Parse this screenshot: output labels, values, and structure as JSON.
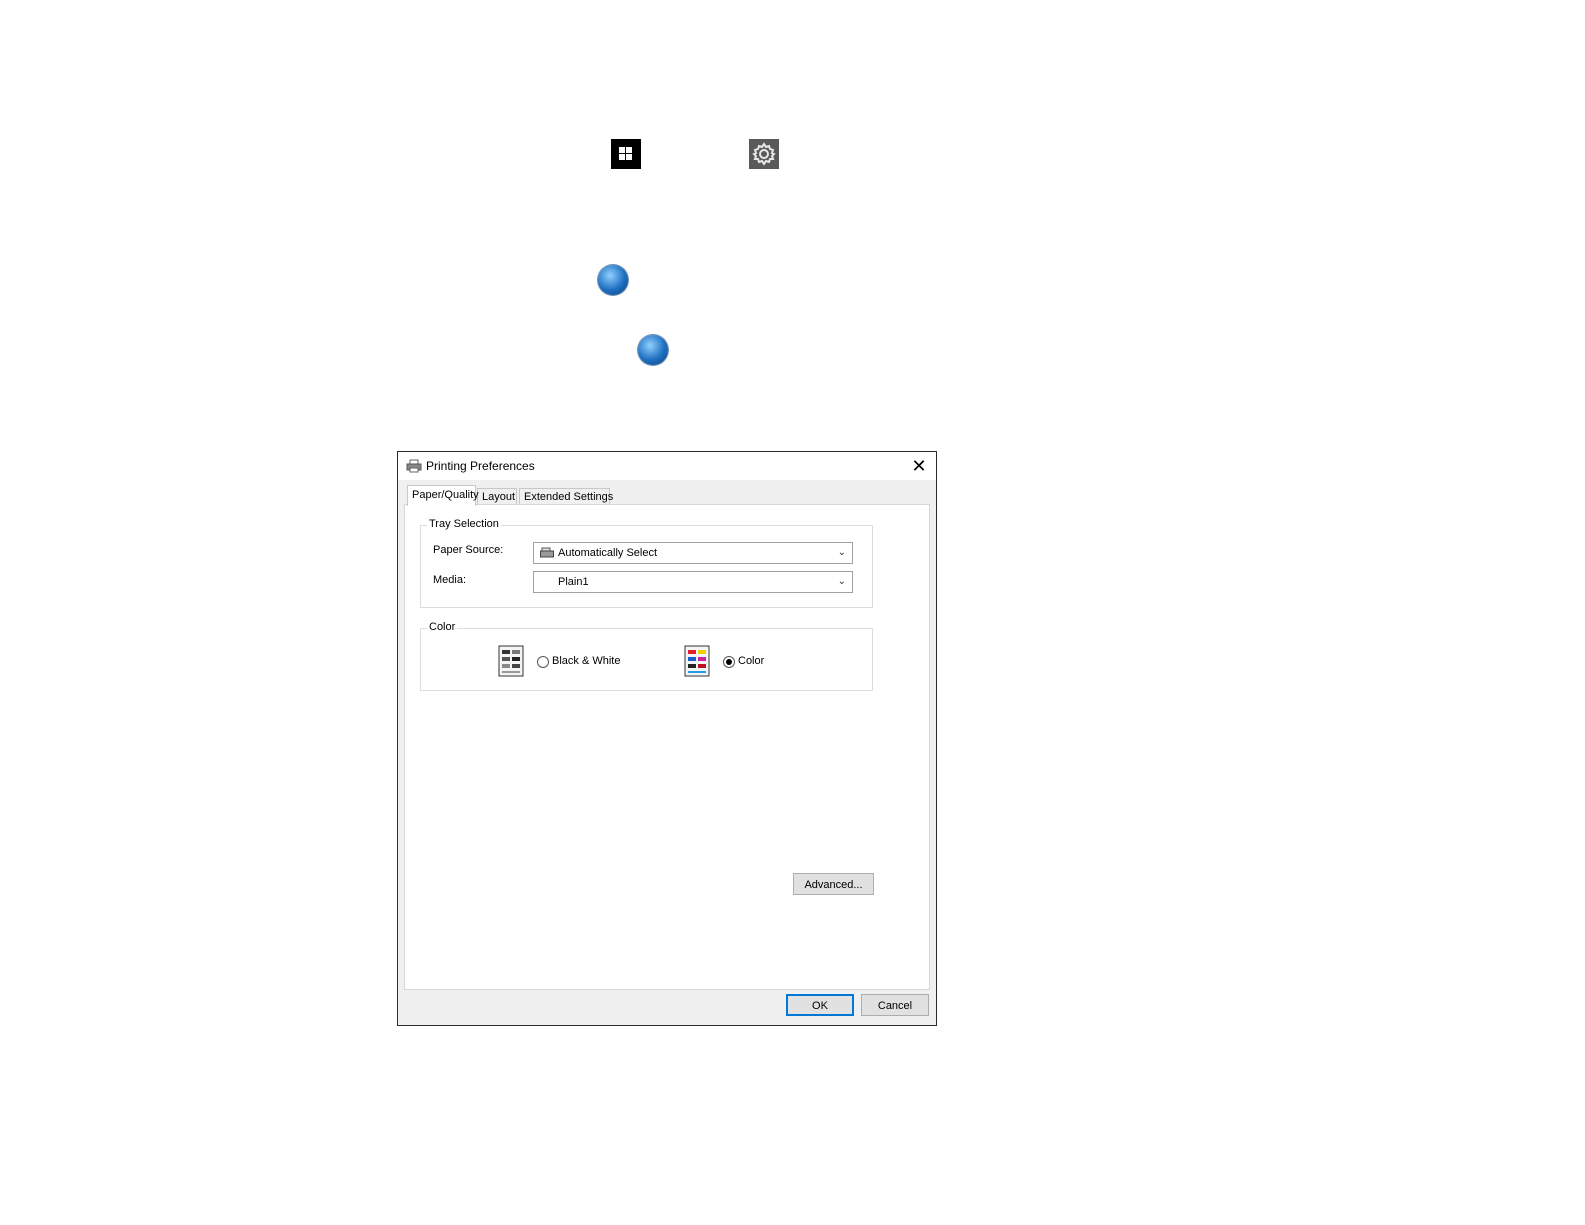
{
  "dialog": {
    "title": "Printing Preferences",
    "close_glyph": "✕",
    "tabs": [
      {
        "label": "Paper/Quality",
        "active": true
      },
      {
        "label": "Layout",
        "active": false
      },
      {
        "label": "Extended Settings",
        "active": false
      }
    ],
    "tray_selection": {
      "legend": "Tray Selection",
      "paper_source_label": "Paper Source:",
      "paper_source_value": "Automatically Select",
      "media_label": "Media:",
      "media_value": "Plain1"
    },
    "color": {
      "legend": "Color",
      "options": [
        {
          "label": "Black & White",
          "selected": false
        },
        {
          "label": "Color",
          "selected": true
        }
      ]
    },
    "advanced_label": "Advanced...",
    "ok_label": "OK",
    "cancel_label": "Cancel"
  },
  "icons": [
    "windows-start-icon",
    "settings-gear-icon",
    "windows7-start-orb-icon",
    "windows7-start-orb-icon"
  ],
  "colors": {
    "accent": "#0078d7",
    "dialog_bg": "#f0f0f0"
  }
}
